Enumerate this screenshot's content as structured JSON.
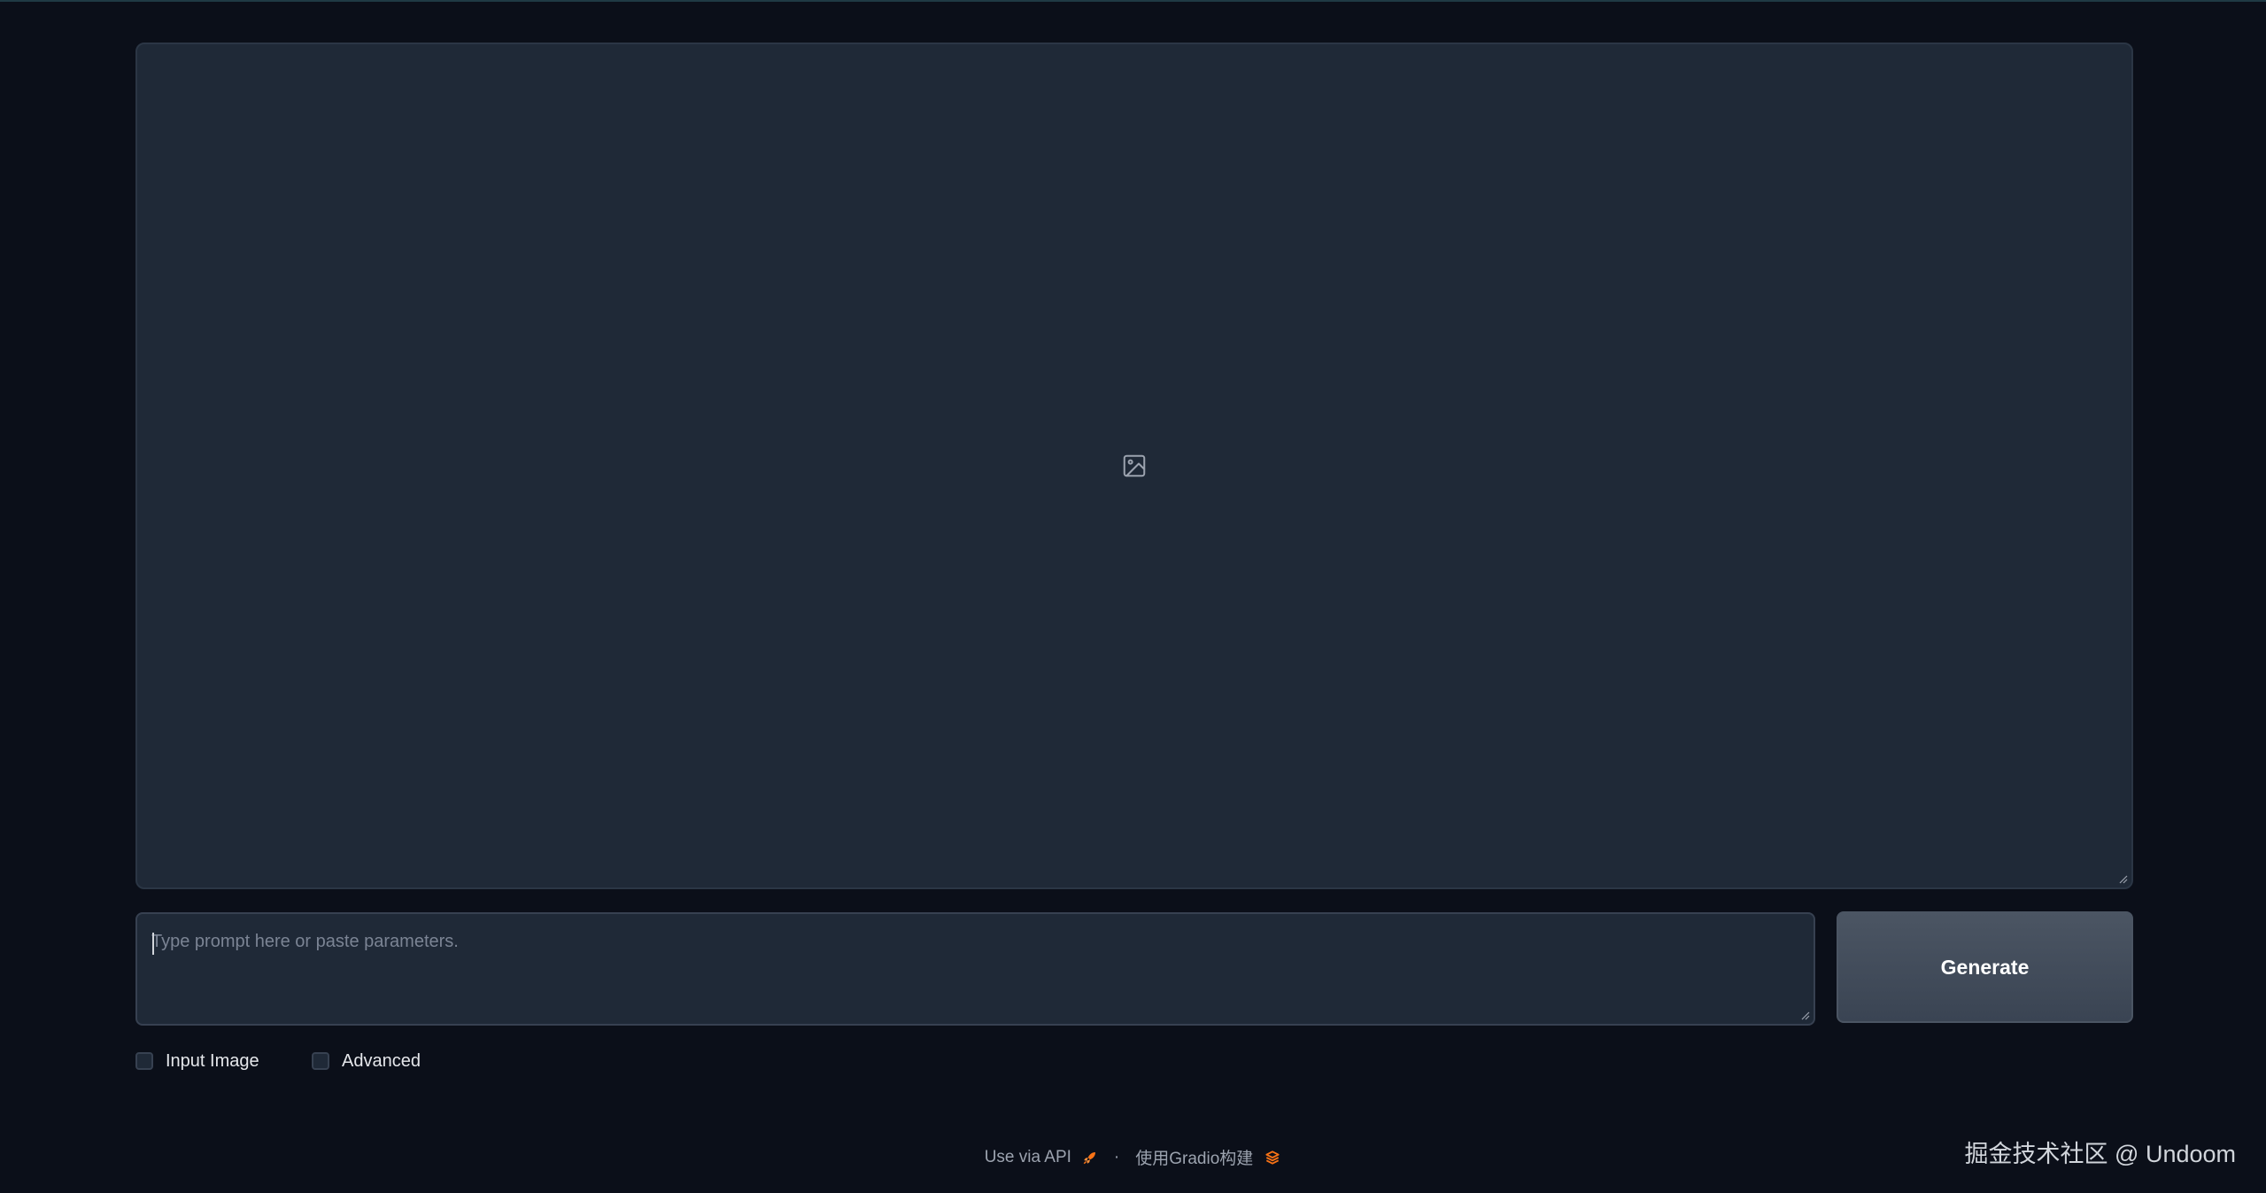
{
  "output_image": {
    "icon": "image-icon"
  },
  "prompt": {
    "value": "",
    "placeholder": "Type prompt here or paste parameters."
  },
  "generate_button": {
    "label": "Generate"
  },
  "options": {
    "input_image_label": "Input Image",
    "input_image_checked": false,
    "advanced_label": "Advanced",
    "advanced_checked": false
  },
  "footer": {
    "api_link": "Use via API",
    "api_icon": "rocket-icon",
    "separator": "·",
    "built_with": "使用Gradio构建",
    "gradio_icon": "gradio-logo-icon"
  },
  "watermark": {
    "text": "掘金技术社区 @ Undoom"
  },
  "colors": {
    "background": "#0b0f19",
    "panel": "#1f2937",
    "border": "#374151",
    "button": "#4b5563",
    "accent": "#f97316"
  }
}
